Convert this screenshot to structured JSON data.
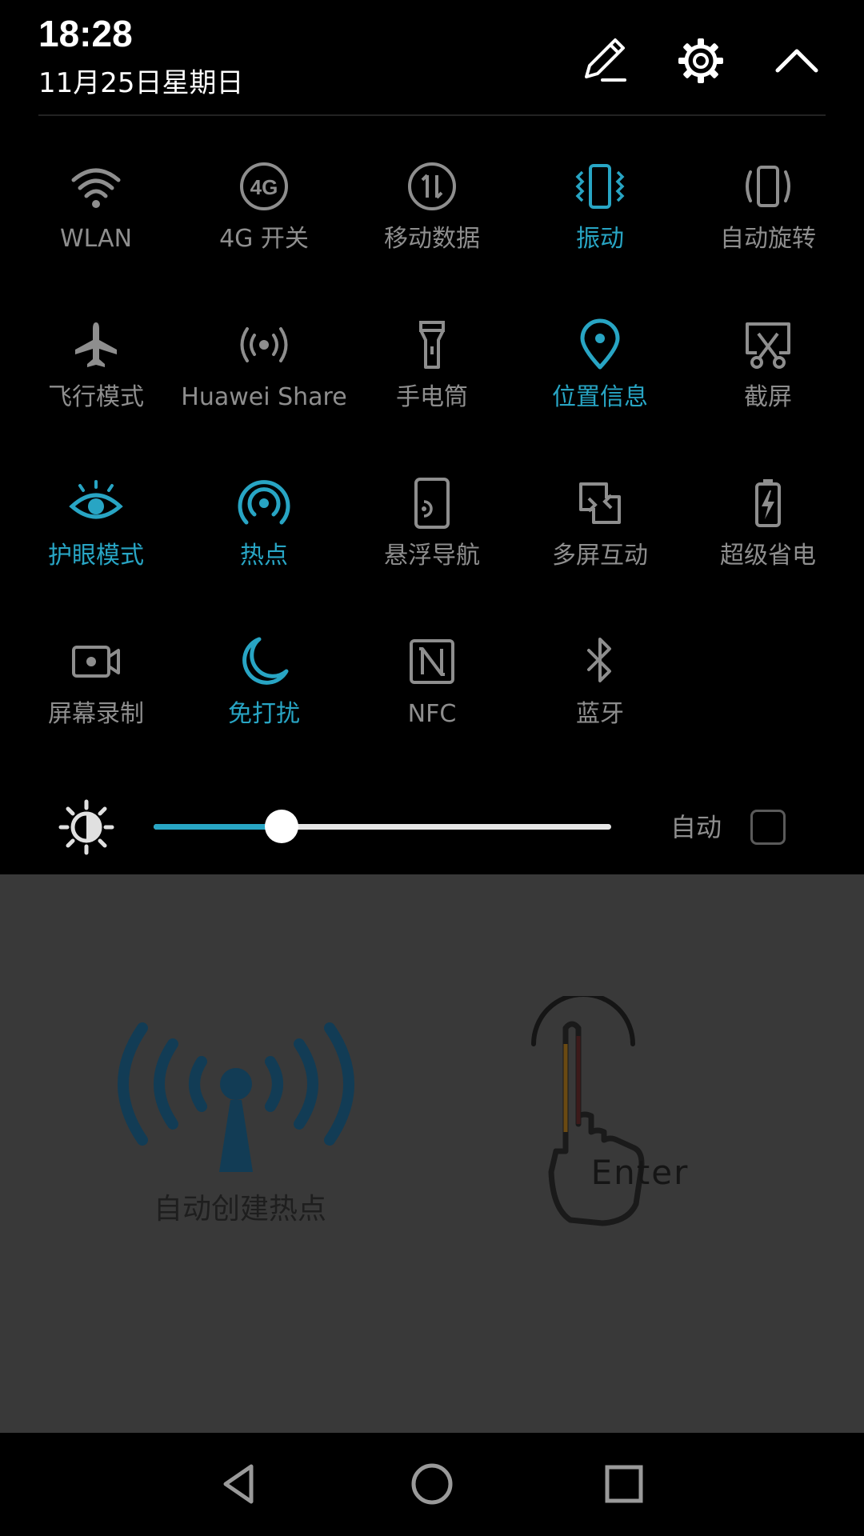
{
  "status": {
    "time": "18:28",
    "date": "11月25日星期日"
  },
  "header_icons": {
    "edit": "edit-pencil-icon",
    "settings": "gear-icon",
    "collapse": "chevron-up-icon"
  },
  "colors": {
    "active": "#28a5c4",
    "inactive": "#8e8e8e",
    "shade_bg": "#000000",
    "app_bg": "#393939"
  },
  "tiles": [
    {
      "label": "WLAN",
      "icon": "wifi-icon",
      "active": false
    },
    {
      "label": "4G 开关",
      "icon": "4g-icon",
      "active": false
    },
    {
      "label": "移动数据",
      "icon": "mobile-data-icon",
      "active": false
    },
    {
      "label": "振动",
      "icon": "vibrate-icon",
      "active": true
    },
    {
      "label": "自动旋转",
      "icon": "auto-rotate-icon",
      "active": false
    },
    {
      "label": "飞行模式",
      "icon": "airplane-icon",
      "active": false
    },
    {
      "label": "Huawei Share",
      "icon": "huawei-share-icon",
      "active": false
    },
    {
      "label": "手电筒",
      "icon": "flashlight-icon",
      "active": false
    },
    {
      "label": "位置信息",
      "icon": "location-pin-icon",
      "active": true
    },
    {
      "label": "截屏",
      "icon": "screenshot-icon",
      "active": false
    },
    {
      "label": "护眼模式",
      "icon": "eye-icon",
      "active": true
    },
    {
      "label": "热点",
      "icon": "hotspot-icon",
      "active": true
    },
    {
      "label": "悬浮导航",
      "icon": "floating-nav-icon",
      "active": false
    },
    {
      "label": "多屏互动",
      "icon": "multi-screen-icon",
      "active": false
    },
    {
      "label": "超级省电",
      "icon": "battery-saver-icon",
      "active": false
    },
    {
      "label": "屏幕录制",
      "icon": "screen-record-icon",
      "active": false
    },
    {
      "label": "免打扰",
      "icon": "moon-icon",
      "active": true
    },
    {
      "label": "NFC",
      "icon": "nfc-icon",
      "active": false
    },
    {
      "label": "蓝牙",
      "icon": "bluetooth-icon",
      "active": false
    }
  ],
  "brightness": {
    "icon": "brightness-sun-icon",
    "level": 0.28,
    "auto_label": "自动",
    "auto_checked": false
  },
  "app": {
    "hotspot_caption": "自动创建热点",
    "hotspot_icon": "hotspot-antenna-icon",
    "enter_text": "Enter",
    "enter_icon": "pointing-hand-icon"
  },
  "navbar": {
    "back": "back-triangle-icon",
    "home": "home-circle-icon",
    "recent": "recent-square-icon"
  }
}
